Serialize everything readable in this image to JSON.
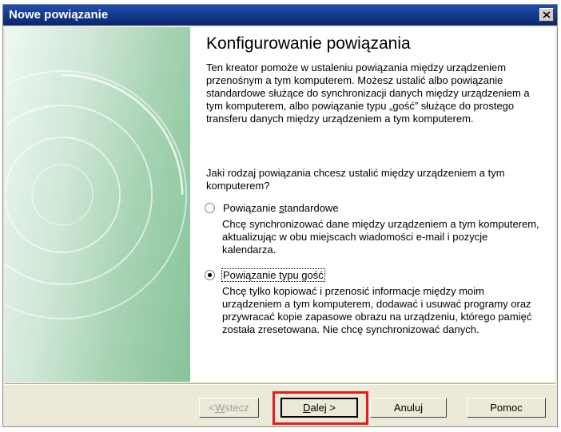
{
  "window": {
    "title": "Nowe powiązanie"
  },
  "content": {
    "heading": "Konfigurowanie powiązania",
    "intro": "Ten kreator pomoże w ustaleniu powiązania między urządzeniem przenośnym a tym komputerem. Możesz ustalić albo powiązanie standardowe służące do synchronizacji danych między urządzeniem a tym komputerem, albo powiązanie typu „gość” służące do prostego transferu danych między urządzeniem a tym komputerem.",
    "question": "Jaki rodzaj powiązania chcesz ustalić między urządzeniem a tym komputerem?",
    "options": [
      {
        "label_pre": "Powiązanie ",
        "label_accel": "s",
        "label_post": "tandardowe",
        "selected": false,
        "description": "Chcę synchronizować dane między urządzeniem a tym komputerem, aktualizując w obu miejscach wiadomości e-mail i pozycje kalendarza."
      },
      {
        "label_pre": "Powiązanie typu gość",
        "label_accel": "",
        "label_post": "",
        "selected": true,
        "description": "Chcę tylko kopiować i przenosić informacje między moim urządzeniem a tym komputerem, dodawać i usuwać programy oraz przywracać kopie zapasowe obrazu na urządzeniu, którego pamięć została zresetowana. Nie chcę synchronizować danych."
      }
    ]
  },
  "buttons": {
    "back_pre": "< ",
    "back_accel": "W",
    "back_post": "stecz",
    "next_accel": "D",
    "next_post": "alej >",
    "cancel": "Anuluj",
    "help": "Pomoc"
  },
  "colors": {
    "title_bar": "#0a246a",
    "highlight": "#e41b1b",
    "dialog_bg": "#ece9d8"
  }
}
